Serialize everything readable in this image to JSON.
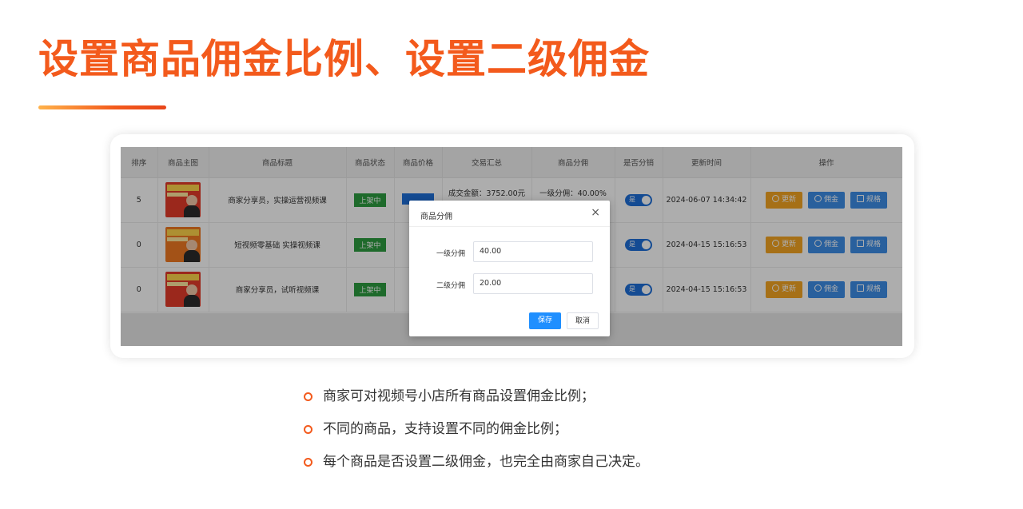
{
  "slide": {
    "title": "设置商品佣金比例、设置二级佣金",
    "accent_color": "#f35a1c"
  },
  "table": {
    "headers": [
      "排序",
      "商品主图",
      "商品标题",
      "商品状态",
      "商品价格",
      "交易汇总",
      "商品分佣",
      "是否分销",
      "更新时间",
      "操作"
    ],
    "rows": [
      {
        "sort": "5",
        "title": "商家分享员，实操运营视频课",
        "status": "上架中",
        "summary": "成交金额：3752.00元",
        "commission": "一级分佣：40.00%",
        "distribute": "是",
        "updated": "2024-06-07 14:34:42"
      },
      {
        "sort": "0",
        "title": "短视频零基础 实操视频课",
        "status": "上架中",
        "summary": "",
        "commission": "",
        "distribute": "是",
        "updated": "2024-04-15 15:16:53"
      },
      {
        "sort": "0",
        "title": "商家分享员，试听视频课",
        "status": "上架中",
        "summary": "",
        "commission": "",
        "distribute": "是",
        "updated": "2024-04-15 15:16:53"
      }
    ],
    "actions": {
      "update": "更新",
      "commission": "佣金",
      "spec": "规格"
    }
  },
  "modal": {
    "title": "商品分佣",
    "close": "×",
    "level1_label": "一级分佣",
    "level1_value": "40.00",
    "level2_label": "二级分佣",
    "level2_value": "20.00",
    "save": "保存",
    "cancel": "取消"
  },
  "bullets": [
    "商家可对视频号小店所有商品设置佣金比例；",
    "不同的商品，支持设置不同的佣金比例；",
    "每个商品是否设置二级佣金，也完全由商家自己决定。"
  ]
}
